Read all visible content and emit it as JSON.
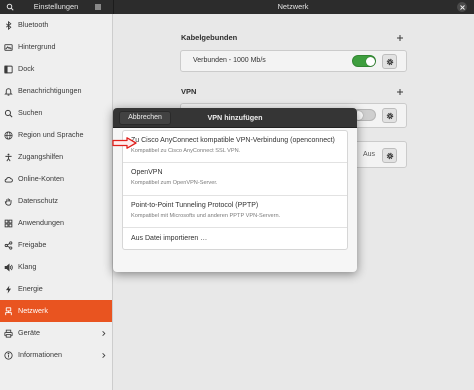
{
  "window": {
    "sidebar_title": "Einstellungen",
    "panel_title": "Netzwerk",
    "icons": {
      "search": "search-icon",
      "menu": "menu-icon",
      "close": "close-icon"
    }
  },
  "sidebar": {
    "items": [
      {
        "label": "Bluetooth",
        "icon": "bluetooth-icon"
      },
      {
        "label": "Hintergrund",
        "icon": "background-icon"
      },
      {
        "label": "Dock",
        "icon": "dock-icon"
      },
      {
        "label": "Benachrichtigungen",
        "icon": "notifications-icon"
      },
      {
        "label": "Suchen",
        "icon": "search-icon"
      },
      {
        "label": "Region und Sprache",
        "icon": "region-icon"
      },
      {
        "label": "Zugangshilfen",
        "icon": "accessibility-icon"
      },
      {
        "label": "Online-Konten",
        "icon": "online-accounts-icon"
      },
      {
        "label": "Datenschutz",
        "icon": "privacy-icon"
      },
      {
        "label": "Anwendungen",
        "icon": "applications-icon"
      },
      {
        "label": "Freigabe",
        "icon": "sharing-icon"
      },
      {
        "label": "Klang",
        "icon": "sound-icon"
      },
      {
        "label": "Energie",
        "icon": "power-icon"
      },
      {
        "label": "Netzwerk",
        "icon": "network-icon",
        "selected": true
      },
      {
        "label": "Geräte",
        "icon": "devices-icon",
        "has_submenu": true
      },
      {
        "label": "Informationen",
        "icon": "info-icon",
        "has_submenu": true
      }
    ]
  },
  "network": {
    "wired": {
      "heading": "Kabelgebunden",
      "status": "Verbunden - 1000 Mb/s",
      "switch_on": true
    },
    "vpn": {
      "heading": "VPN",
      "switch_on": false
    },
    "proxy": {
      "status": "Aus"
    }
  },
  "dialog": {
    "title": "VPN hinzufügen",
    "cancel_label": "Abbrechen",
    "options": [
      {
        "title": "Zu Cisco AnyConnect kompatible VPN-Verbindung (openconnect)",
        "subtitle": "Kompatibel zu Cisco AnyConnect SSL VPN."
      },
      {
        "title": "OpenVPN",
        "subtitle": "Kompatibel zum OpenVPN-Server."
      },
      {
        "title": "Point-to-Point Tunneling Protocol (PPTP)",
        "subtitle": "Kompatibel mit Microsofts und anderen PPTP VPN-Servern."
      },
      {
        "title": "Aus Datei importieren …"
      }
    ]
  },
  "colors": {
    "accent": "#e95420",
    "switch_on": "#3e9e3e",
    "headerbar": "#2c2c2c",
    "dialog_header": "#353535",
    "annotation": "#e0201c"
  }
}
